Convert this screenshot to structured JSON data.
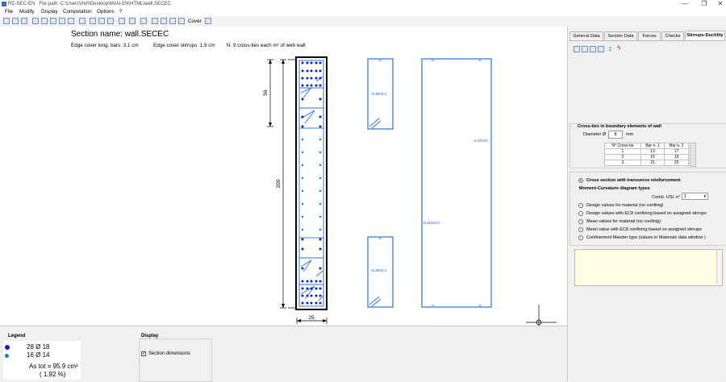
{
  "titlebar": {
    "app": "RC-SEC-EN",
    "path_label": "File path:",
    "path": "C:\\Users\\rhrh\\Desktop\\MAN-EN\\HTML\\wall.SECEC",
    "minimize": "—",
    "restore": "❐",
    "close": "✕"
  },
  "menu": [
    "File",
    "Modify",
    "Display",
    "Computation",
    "Options",
    "?"
  ],
  "toolbar": {
    "cover_label": "Cover"
  },
  "drawing": {
    "section_name": "Section name: wall.SECEC",
    "edge_cover_long": "Edge cover long. bars: 3.1 cm",
    "edge_cover_stirrups": "Edge cover stirrups: 1.9 cm",
    "cross_ties": "N. 9 cross-ties each m² of web wall",
    "dim_56": "56",
    "dim_200": "200",
    "dim_25": "25",
    "stirrup_label_top": "St.Ø8/8.0",
    "stirrup_label_bottom": "St.Ø8/8.0",
    "stirrup_label_right_top": "St.Ø12/8.",
    "stirrup_label_right_mid": "St.Ø12/8.0"
  },
  "colors": {
    "bar_large": "#0d1fc9",
    "bar_small": "#0f8a8f",
    "stirrup": "#2a74d6",
    "outline": "#000000"
  },
  "legend": {
    "title": "Legend",
    "row1": "28 Ø 18",
    "row2": "16 Ø 14",
    "as_tot": "As tot = 95.9 cm²",
    "percent": "( 1.92 %)"
  },
  "display": {
    "title": "Display",
    "section_dimensions": "Section dimensions"
  },
  "panel": {
    "tabs": [
      "General Data",
      "Section Data",
      "Forces",
      "Checks",
      "Stirrups-Ductility"
    ],
    "crossties_title": "Cross-ties in boundary elements of wall",
    "diameter_label": "Diameter Ø",
    "diameter_value": "8",
    "diameter_unit": "mm",
    "table_headers": [
      "N° Cross-tie",
      "Bar n. 1",
      "Bar n. 2"
    ],
    "table_rows": [
      [
        "1",
        "13",
        "17"
      ],
      [
        "2",
        "15",
        "19"
      ],
      [
        "3",
        "21",
        "25"
      ]
    ],
    "cross_section_option": "Cross section with transverse reinforcement",
    "mc_title": "Moment-Curvature diagram types",
    "comb_label": "Comb. USL n°",
    "comb_value": "1",
    "options": [
      "Design values for material (no confinig)",
      "Design values with EC8 confining based on assigned stirrups",
      "Mean values for material (no confinig)",
      "Mean value with EC8 confining based on assigned stirrups",
      "Confinement Mander type (values in Materials data window )"
    ]
  }
}
